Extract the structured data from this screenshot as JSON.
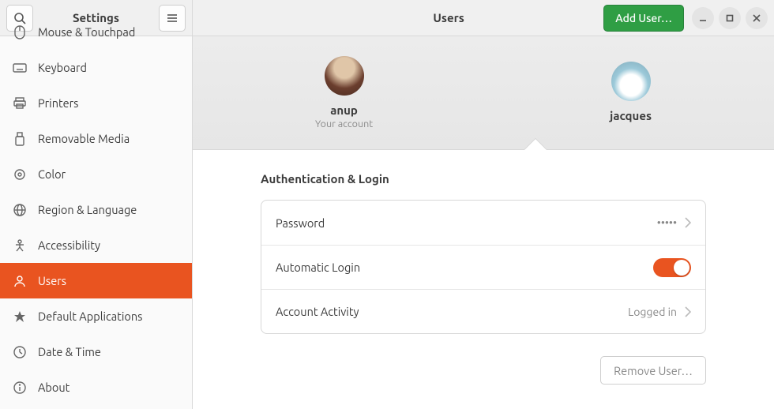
{
  "app_title": "Settings",
  "main_title": "Users",
  "add_user_label": "Add User…",
  "sidebar": {
    "items": [
      {
        "label": "Mouse & Touchpad",
        "icon": "mouse"
      },
      {
        "label": "Keyboard",
        "icon": "keyboard"
      },
      {
        "label": "Printers",
        "icon": "printer"
      },
      {
        "label": "Removable Media",
        "icon": "usb"
      },
      {
        "label": "Color",
        "icon": "color"
      },
      {
        "label": "Region & Language",
        "icon": "globe"
      },
      {
        "label": "Accessibility",
        "icon": "accessibility"
      },
      {
        "label": "Users",
        "icon": "user",
        "active": true
      },
      {
        "label": "Default Applications",
        "icon": "star"
      },
      {
        "label": "Date & Time",
        "icon": "clock"
      },
      {
        "label": "About",
        "icon": "info"
      }
    ]
  },
  "users": [
    {
      "name": "anup",
      "subtitle": "Your account",
      "selected": true
    },
    {
      "name": "jacques",
      "subtitle": "",
      "selected": false
    }
  ],
  "auth": {
    "section_title": "Authentication & Login",
    "password_label": "Password",
    "password_value": "•••••",
    "autologin_label": "Automatic Login",
    "autologin_on": true,
    "activity_label": "Account Activity",
    "activity_value": "Logged in"
  },
  "remove_user_label": "Remove User…",
  "colors": {
    "accent": "#e95420",
    "primary_btn": "#2f9e44"
  }
}
